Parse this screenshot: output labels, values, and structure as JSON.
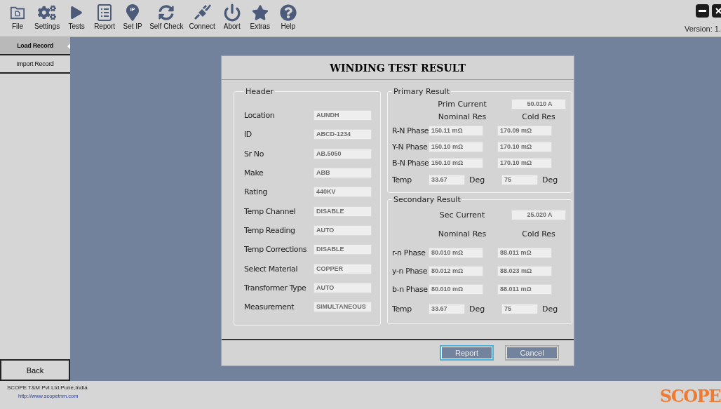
{
  "toolbar": {
    "items": [
      {
        "label": "File"
      },
      {
        "label": "Settings"
      },
      {
        "label": "Tests"
      },
      {
        "label": "Report"
      },
      {
        "label": "Set IP",
        "icon_text": "IP"
      },
      {
        "label": "Self Check"
      },
      {
        "label": "Connect"
      },
      {
        "label": "Abort"
      },
      {
        "label": "Extras"
      },
      {
        "label": "Help"
      }
    ],
    "version": "Version: 1."
  },
  "sidebar": {
    "items": [
      {
        "label": "Load Record",
        "selected": true
      },
      {
        "label": "Import Record",
        "selected": false
      }
    ],
    "back": "Back"
  },
  "dialog": {
    "title": "WINDING TEST RESULT",
    "header": {
      "title": "Header",
      "fields": [
        {
          "label": "Location",
          "value": "AUNDH"
        },
        {
          "label": "ID",
          "value": "ABCD-1234"
        },
        {
          "label": "Sr No",
          "value": "AB.5050"
        },
        {
          "label": "Make",
          "value": "ABB"
        },
        {
          "label": "Rating",
          "value": "440KV"
        },
        {
          "label": "Temp Channel",
          "value": "DISABLE"
        },
        {
          "label": "Temp Reading",
          "value": "AUTO"
        },
        {
          "label": "Temp Corrections",
          "value": "DISABLE"
        },
        {
          "label": "Select Material",
          "value": "COPPER"
        },
        {
          "label": "Transformer Type",
          "value": "AUTO"
        },
        {
          "label": "Measurement",
          "value": "SIMULTANEOUS"
        }
      ]
    },
    "results": [
      {
        "title": "Primary Result",
        "current_label": "Prim Current",
        "current_value": "50.010 A",
        "columns": [
          "Nominal Res",
          "Cold Res"
        ],
        "rows": [
          {
            "label": "R-N Phase",
            "nominal": "150.11 mΩ",
            "cold": "170.09 mΩ"
          },
          {
            "label": "Y-N Phase",
            "nominal": "150.10 mΩ",
            "cold": "170.10 mΩ"
          },
          {
            "label": "B-N Phase",
            "nominal": "150.10 mΩ",
            "cold": "170.10 mΩ"
          }
        ],
        "temp": {
          "label": "Temp",
          "nominal": "33.67",
          "nominal_unit": "Deg",
          "cold": "75",
          "cold_unit": "Deg"
        }
      },
      {
        "title": "Secondary Result",
        "current_label": "Sec Current",
        "current_value": "25.020 A",
        "columns": [
          "Nominal Res",
          "Cold Res"
        ],
        "rows": [
          {
            "label": "r-n Phase",
            "nominal": "80.010 mΩ",
            "cold": "88.011 mΩ"
          },
          {
            "label": "y-n Phase",
            "nominal": "80.012 mΩ",
            "cold": "88.023 mΩ"
          },
          {
            "label": "b-n Phase",
            "nominal": "80.010 mΩ",
            "cold": "88.011 mΩ"
          }
        ],
        "temp": {
          "label": "Temp",
          "nominal": "33.67",
          "nominal_unit": "Deg",
          "cold": "75",
          "cold_unit": "Deg"
        }
      }
    ],
    "buttons": [
      {
        "label": "Report",
        "focused": true
      },
      {
        "label": "Cancel",
        "focused": false
      }
    ]
  },
  "footer": {
    "company": "SCOPE T&M Pvt Ltd.Pune,India",
    "link": "http://www.scopetnm.com",
    "logo": "SCOPE"
  }
}
